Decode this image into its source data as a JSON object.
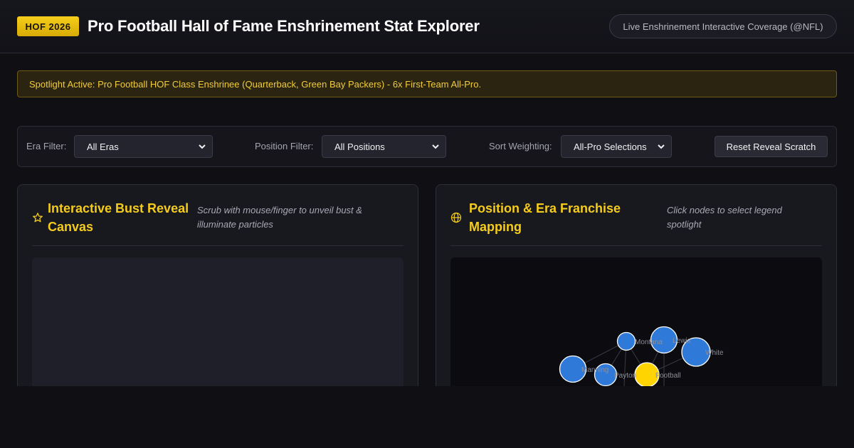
{
  "header": {
    "badge": "HOF 2026",
    "title": "Pro Football Hall of Fame Enshrinement Stat Explorer",
    "live_label": "Live Enshrinement Interactive Coverage (@NFL)"
  },
  "spotlight": {
    "text": "Spotlight Active: Pro Football HOF Class Enshrinee (Quarterback, Green Bay Packers) - 6x First-Team All-Pro."
  },
  "controls": {
    "era_label": "Era Filter:",
    "era_value": "All Eras",
    "position_label": "Position Filter:",
    "position_value": "All Positions",
    "sort_label": "Sort Weighting:",
    "sort_value": "All-Pro Selections",
    "reset_label": "Reset Reveal Scratch"
  },
  "bust_card": {
    "icon": "star-icon",
    "title": "Interactive Bust Reveal Canvas",
    "hint": "Scrub with mouse/finger to unveil bust & illuminate particles"
  },
  "network_card": {
    "icon": "globe-icon",
    "title": "Position & Era Franchise Mapping",
    "hint": "Click nodes to select legend spotlight",
    "nodes": [
      {
        "label": "Montana"
      },
      {
        "label": "Lewis"
      },
      {
        "label": "White"
      },
      {
        "label": "Manning"
      },
      {
        "label": "Payton"
      },
      {
        "label": "Football"
      }
    ]
  },
  "colors": {
    "accent": "#f5cc1c",
    "node_blue": "#2f7ad8",
    "node_highlight": "#ffd400",
    "background": "#0f0f14"
  }
}
